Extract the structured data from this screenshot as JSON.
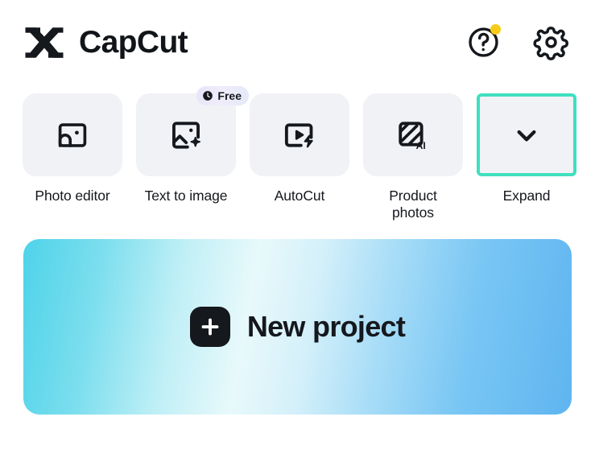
{
  "app": {
    "brand_name": "CapCut",
    "logo_icon": "capcut-logo-icon",
    "background_color": "#FFFFFF"
  },
  "header": {
    "help_button": {
      "icon": "help-circle-icon",
      "has_notification_dot": true,
      "notification_dot_color": "#F7CC18"
    },
    "settings_button": {
      "icon": "gear-icon"
    }
  },
  "tools": {
    "items": [
      {
        "label": "Photo editor",
        "icon": "photo-editor-icon",
        "badge": null,
        "selected": false
      },
      {
        "label": "Text to image",
        "icon": "text-to-image-icon",
        "badge": {
          "text": "Free",
          "icon": "clock-icon"
        },
        "selected": false
      },
      {
        "label": "AutoCut",
        "icon": "autocut-icon",
        "badge": null,
        "selected": false
      },
      {
        "label": "Product\nphotos",
        "icon": "product-photos-ai-icon",
        "badge": null,
        "selected": false
      },
      {
        "label": "Expand",
        "icon": "chevron-down-icon",
        "badge": null,
        "selected": true
      }
    ],
    "selection_color": "#3FE0BE",
    "card_background": "#F0F2F5"
  },
  "new_project": {
    "label": "New project",
    "icon": "plus-icon",
    "gradient_start": "#4ED3E9",
    "gradient_mid": "#E8F9FB",
    "gradient_end": "#5FB5F0"
  }
}
